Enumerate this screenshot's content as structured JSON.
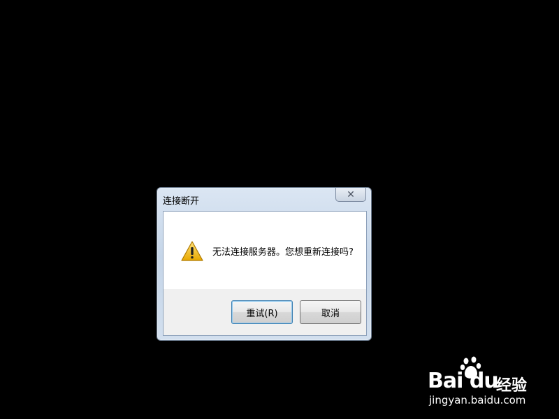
{
  "dialog": {
    "title": "连接断开",
    "close_label": "✕",
    "message": "无法连接服务器。您想重新连接吗?",
    "buttons": {
      "retry": "重试(R)",
      "cancel": "取消"
    },
    "icon": "warning-icon"
  },
  "watermark": {
    "brand": "Bai du",
    "cn": "经验",
    "url": "jingyan.baidu.com"
  }
}
